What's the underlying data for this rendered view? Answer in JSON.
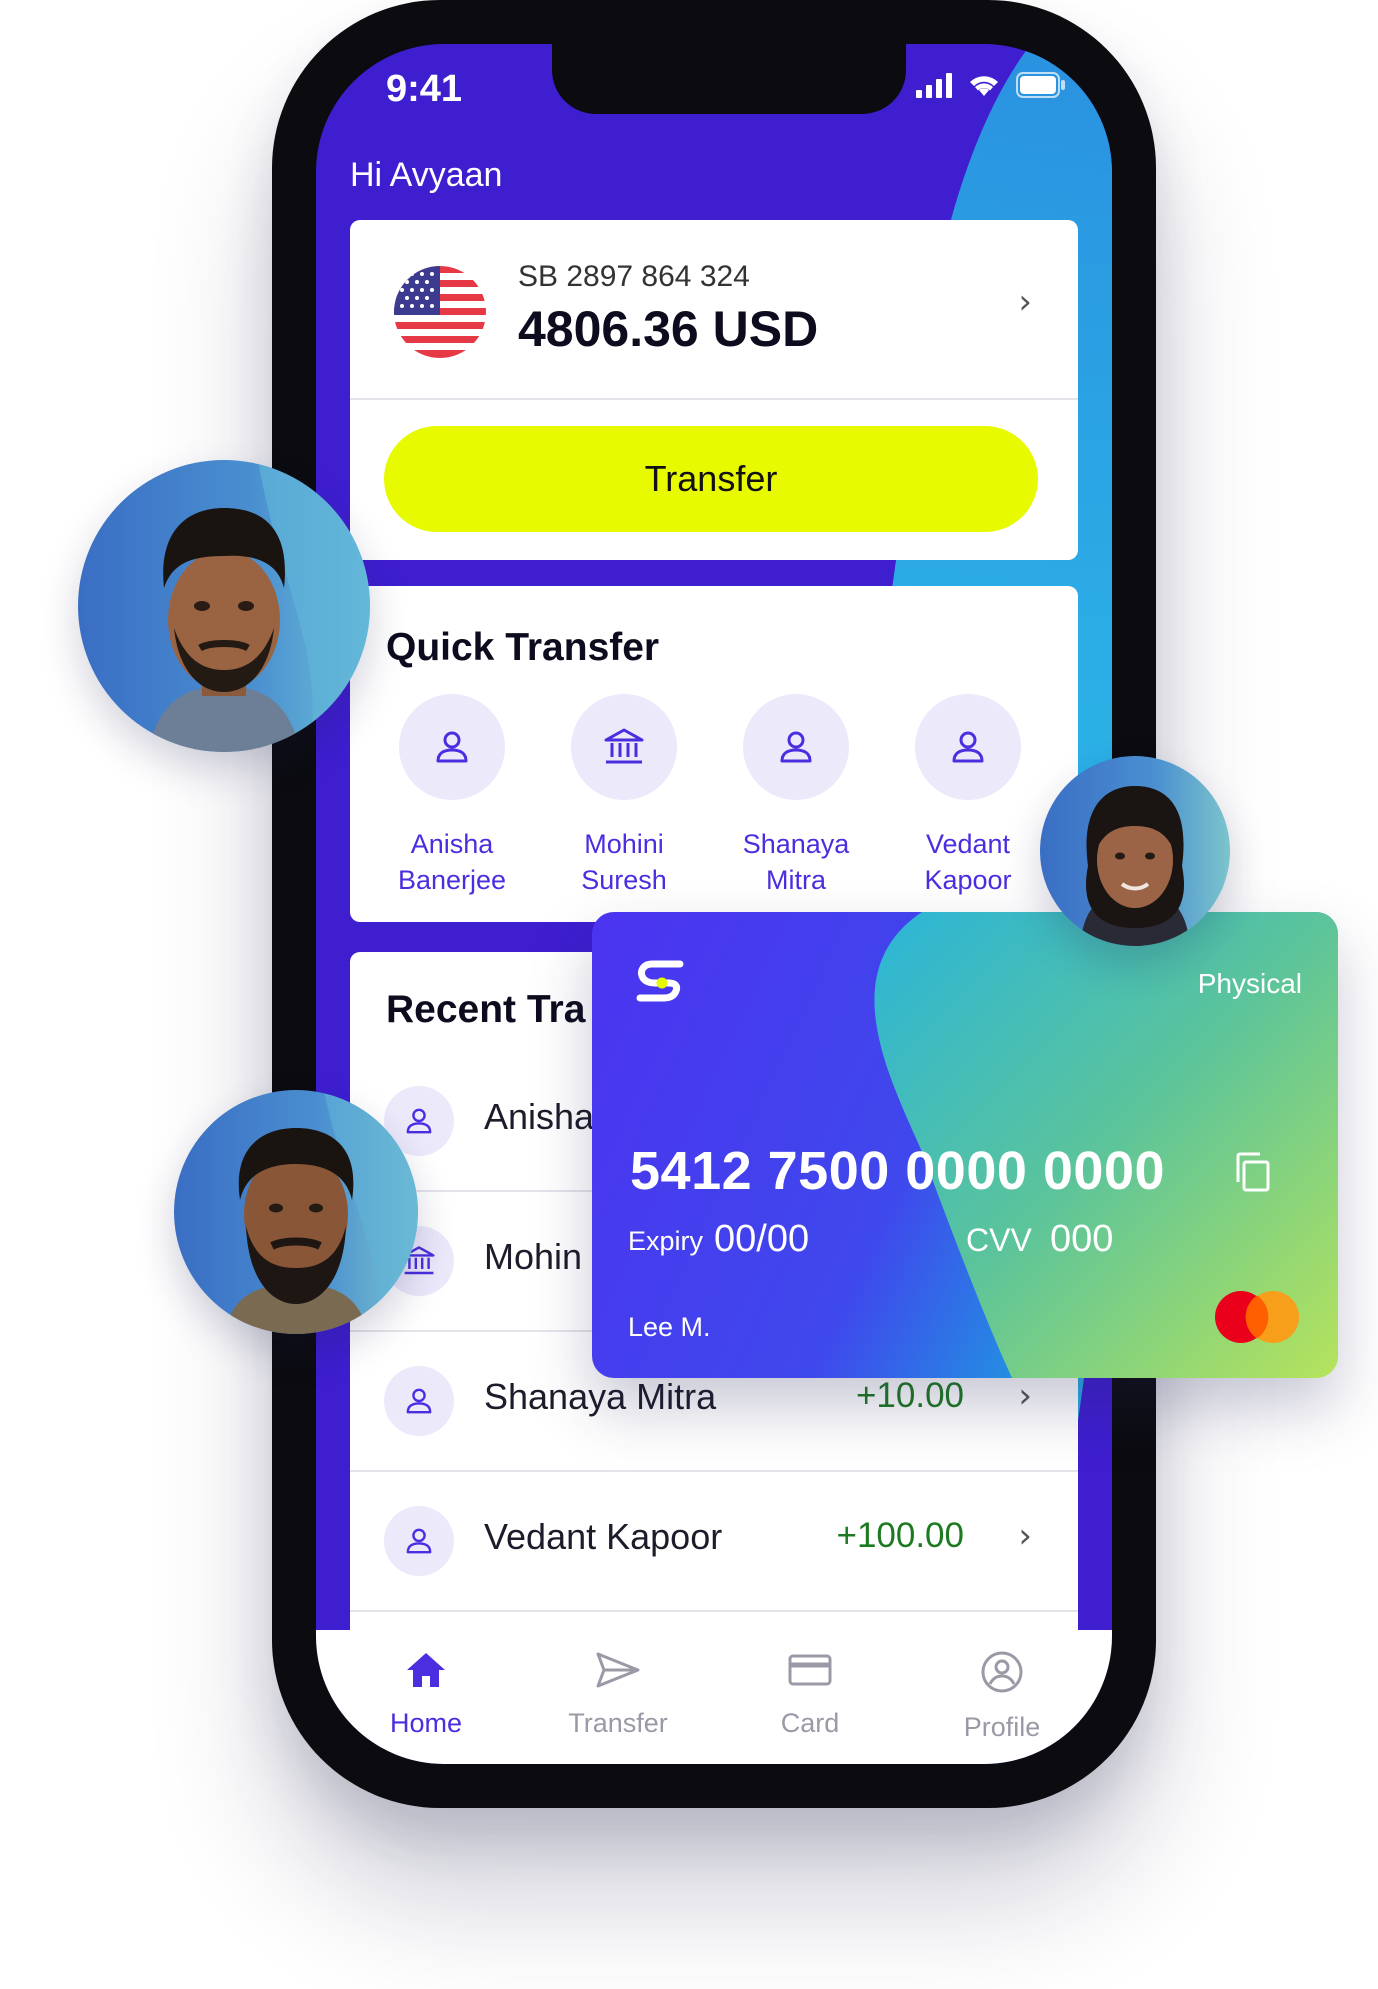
{
  "status_bar": {
    "time": "9:41"
  },
  "header": {
    "greeting": "Hi Avyaan"
  },
  "account": {
    "number": "SB 2897 864 324",
    "balance": "4806.36 USD",
    "transfer_label": "Transfer"
  },
  "quick_transfer": {
    "title": "Quick Transfer",
    "contacts": [
      {
        "first": "Anisha",
        "last": "Banerjee",
        "icon": "user-icon"
      },
      {
        "first": "Mohini",
        "last": "Suresh",
        "icon": "bank-icon"
      },
      {
        "first": "Shanaya",
        "last": "Mitra",
        "icon": "user-icon"
      },
      {
        "first": "Vedant",
        "last": "Kapoor",
        "icon": "user-icon"
      }
    ]
  },
  "recent": {
    "title": "Recent Tra",
    "transactions": [
      {
        "name": "Anisha",
        "amount": "",
        "icon": "user-icon"
      },
      {
        "name": "Mohin",
        "amount": "",
        "icon": "bank-icon"
      },
      {
        "name": "Shanaya Mitra",
        "amount": "+10.00",
        "icon": "user-icon"
      },
      {
        "name": "Vedant Kapoor",
        "amount": "+100.00",
        "icon": "user-icon"
      }
    ]
  },
  "card": {
    "type": "Physical",
    "number": "5412 7500 0000 0000",
    "expiry_label": "Expiry",
    "expiry_value": "00/00",
    "cvv_label": "CVV",
    "cvv_value": "000",
    "holder": "Lee M."
  },
  "bottom_nav": [
    {
      "label": "Home",
      "icon": "home-icon",
      "active": true
    },
    {
      "label": "Transfer",
      "icon": "send-icon",
      "active": false
    },
    {
      "label": "Card",
      "icon": "card-icon",
      "active": false
    },
    {
      "label": "Profile",
      "icon": "profile-icon",
      "active": false
    }
  ],
  "colors": {
    "primary": "#3e1ecf",
    "accent_blue": "#2a9fe4",
    "button": "#e8fa00",
    "positive": "#1e7a22",
    "link": "#4a2ee0"
  }
}
